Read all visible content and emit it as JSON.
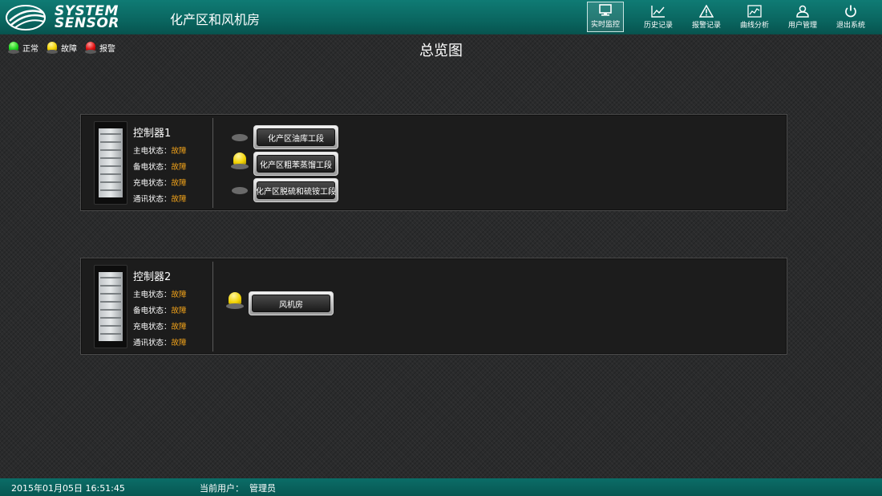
{
  "header": {
    "logo_line1": "SYSTEM",
    "logo_line2": "SENSOR",
    "title": "化产区和风机房",
    "nav": [
      {
        "label": "实时监控",
        "icon": "monitor-icon"
      },
      {
        "label": "历史记录",
        "icon": "line-chart-icon"
      },
      {
        "label": "报警记录",
        "icon": "warning-icon"
      },
      {
        "label": "曲线分析",
        "icon": "curve-chart-icon"
      },
      {
        "label": "用户管理",
        "icon": "user-icon"
      },
      {
        "label": "退出系统",
        "icon": "power-icon"
      }
    ],
    "active_nav": "实时监控"
  },
  "legend": [
    {
      "label": "正常",
      "color": "#1fd41f"
    },
    {
      "label": "故障",
      "color": "#f2d200"
    },
    {
      "label": "报警",
      "color": "#e01010"
    }
  ],
  "page_title": "总览图",
  "colors": {
    "accent": "#0a6660",
    "status_value": "#f0a21a"
  },
  "controllers": [
    {
      "name": "控制器1",
      "statuses": [
        {
          "label": "主电状态：",
          "value": "故障"
        },
        {
          "label": "备电状态：",
          "value": "故障"
        },
        {
          "label": "充电状态：",
          "value": "故障"
        },
        {
          "label": "通讯状态：",
          "value": "故障"
        }
      ],
      "zones": [
        {
          "label": "化产区油库工段",
          "state": "off"
        },
        {
          "label": "化产区粗苯蒸馏工段",
          "state": "fault"
        },
        {
          "label": "化产区脱硫和硫铵工段",
          "state": "off"
        }
      ]
    },
    {
      "name": "控制器2",
      "statuses": [
        {
          "label": "主电状态：",
          "value": "故障"
        },
        {
          "label": "备电状态：",
          "value": "故障"
        },
        {
          "label": "充电状态：",
          "value": "故障"
        },
        {
          "label": "通讯状态：",
          "value": "故障"
        }
      ],
      "zones": [
        {
          "label": "风机房",
          "state": "fault"
        }
      ]
    }
  ],
  "footer": {
    "datetime": "2015年01月05日 16:51:45",
    "user_label": "当前用户：",
    "user_name": "管理员"
  }
}
